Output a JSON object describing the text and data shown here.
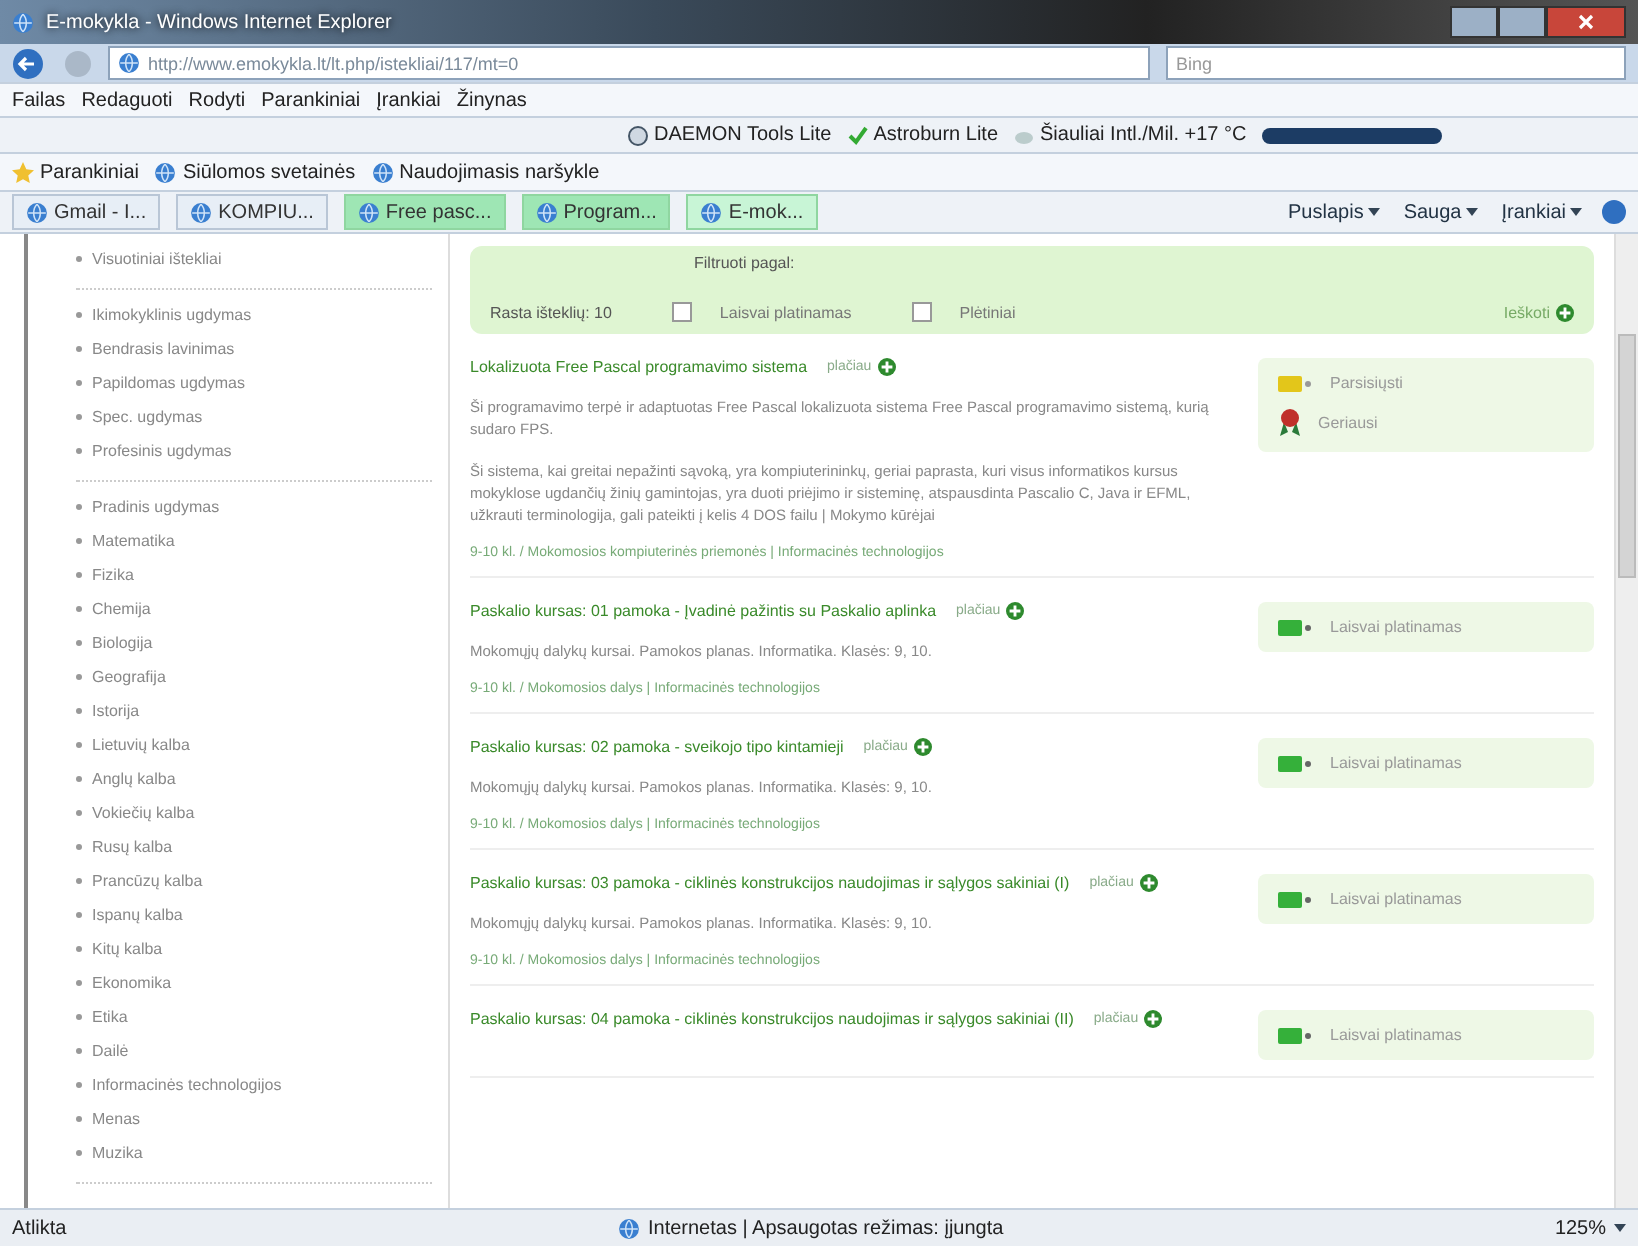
{
  "window": {
    "title": "E-mokykla - Windows Internet Explorer",
    "address": "http://www.emokykla.lt/lt.php/istekliai/117/mt=0",
    "search_placeholder": "Bing"
  },
  "menu": [
    "Failas",
    "Redaguoti",
    "Rodyti",
    "Parankiniai",
    "Įrankiai",
    "Žinynas"
  ],
  "toolbar": [
    {
      "kind": "daemon",
      "label": "DAEMON Tools Lite"
    },
    {
      "kind": "astro",
      "label": "Astroburn Lite"
    },
    {
      "kind": "weather",
      "label": "Šiauliai Intl./Mil. +17 °C"
    }
  ],
  "favorites": [
    {
      "kind": "star",
      "label": "Parankiniai"
    },
    {
      "kind": "page",
      "label": "Siūlomos svetainės"
    },
    {
      "kind": "page",
      "label": "Naudojimasis naršykle"
    }
  ],
  "tabs": [
    {
      "label": "Gmail - I...",
      "grouped": false,
      "selected": false
    },
    {
      "label": "KOMPIU...",
      "grouped": false,
      "selected": false
    },
    {
      "label": "Free pasc...",
      "grouped": true,
      "selected": false
    },
    {
      "label": "Program...",
      "grouped": true,
      "selected": false
    },
    {
      "label": "E-mok...",
      "grouped": true,
      "selected": true
    }
  ],
  "commands": [
    "Puslapis",
    "Sauga",
    "Įrankiai"
  ],
  "sidebar": {
    "groups": [
      [
        "Visuotiniai ištekliai"
      ],
      [
        "Ikimokyklinis ugdymas",
        "Bendrasis lavinimas",
        "Papildomas ugdymas",
        "Spec. ugdymas",
        "Profesinis ugdymas"
      ],
      [
        "Pradinis ugdymas",
        "Matematika",
        "Fizika",
        "Chemija",
        "Biologija",
        "Geografija",
        "Istorija",
        "Lietuvių kalba",
        "Anglų kalba",
        "Vokiečių kalba",
        "Rusų kalba",
        "Prancūzų kalba",
        "Ispanų kalba",
        "Kitų kalba",
        "Ekonomika",
        "Etika",
        "Dailė",
        "Informacinės technologijos",
        "Menas",
        "Muzika"
      ]
    ]
  },
  "filter": {
    "count": "Rasta išteklių: 10",
    "heading": "Filtruoti pagal:",
    "options": [
      {
        "label": "Laisvai platinamas",
        "checked": false
      },
      {
        "label": "Plėtiniai",
        "checked": false
      }
    ],
    "search_label": "Ieškoti"
  },
  "resources": [
    {
      "title": "Lokalizuota Free Pascal programavimo sistema",
      "more": "plačiau",
      "paragraphs": [
        "Ši programavimo terpė ir adaptuotas Free Pascal lokalizuota sistema Free Pascal programavimo sistemą, kurią sudaro FPS.",
        "Ši sistema, kai greitai nepažinti sąvoką, yra kompiuterininkų, geriai paprasta, kuri visus informatikos kursus mokyklose ugdančių žinių gamintojas, yra duoti priėjimo ir sisteminę, atspausdinta Pascalio C, Java ir EFML, užkrauti terminologija, gali pateikti į kelis 4 DOS failu | Mokymo kūrėjai"
      ],
      "meta": "9-10 kl. / Mokomosios kompiuterinės priemonės | Informacinės technologijos",
      "actions": [
        {
          "kind": "download",
          "label": "Parsisiųsti"
        },
        {
          "kind": "award",
          "label": "Geriausi"
        }
      ]
    },
    {
      "title": "Paskalio kursas: 01 pamoka - Įvadinė pažintis su Paskalio aplinka",
      "more": "plačiau",
      "paragraphs": [
        "Mokomųjų dalykų kursai. Pamokos planas. Informatika. Klasės: 9, 10."
      ],
      "meta": "9-10 kl. / Mokomosios dalys | Informacinės technologijos",
      "actions": [
        {
          "kind": "free",
          "label": "Laisvai platinamas"
        }
      ]
    },
    {
      "title": "Paskalio kursas: 02 pamoka - sveikojo tipo kintamieji",
      "more": "plačiau",
      "paragraphs": [
        "Mokomųjų dalykų kursai. Pamokos planas. Informatika. Klasės: 9, 10."
      ],
      "meta": "9-10 kl. / Mokomosios dalys | Informacinės technologijos",
      "actions": [
        {
          "kind": "free",
          "label": "Laisvai platinamas"
        }
      ]
    },
    {
      "title": "Paskalio kursas: 03 pamoka - ciklinės konstrukcijos naudojimas ir sąlygos sakiniai (I)",
      "more": "plačiau",
      "paragraphs": [
        "Mokomųjų dalykų kursai. Pamokos planas. Informatika. Klasės: 9, 10."
      ],
      "meta": "9-10 kl. / Mokomosios dalys | Informacinės technologijos",
      "actions": [
        {
          "kind": "free",
          "label": "Laisvai platinamas"
        }
      ]
    },
    {
      "title": "Paskalio kursas: 04 pamoka - ciklinės konstrukcijos naudojimas ir sąlygos sakiniai (II)",
      "more": "plačiau",
      "actions": [
        {
          "kind": "free",
          "label": "Laisvai platinamas"
        }
      ]
    }
  ],
  "status_bar": {
    "text": "Atlikta",
    "zone": "Internetas | Apsaugotas režimas: įjungta",
    "zoom": "125%"
  }
}
